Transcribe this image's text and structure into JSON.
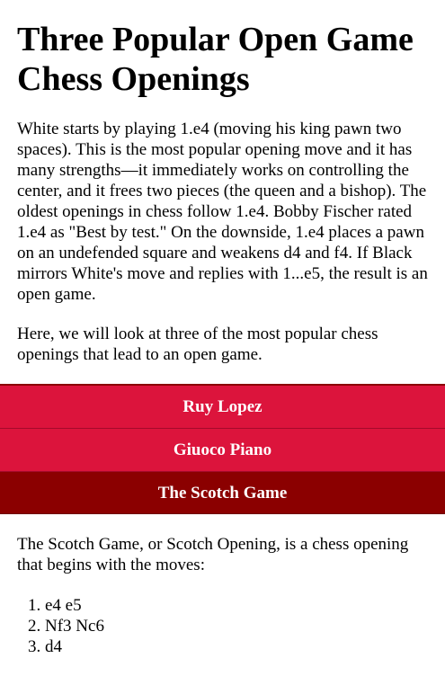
{
  "article": {
    "title": "Three Popular Open Game Chess Openings",
    "intro": "White starts by playing 1.e4 (moving his king pawn two spaces). This is the most popular opening move and it has many strengths—it immediately works on controlling the center, and it frees two pieces (the queen and a bishop). The oldest openings in chess follow 1.e4. Bobby Fischer rated 1.e4 as \"Best by test.\" On the downside, 1.e4 places a pawn on an undefended square and weakens d4 and f4. If Black mirrors White's move and replies with 1...e5, the result is an open game.",
    "intro2": "Here, we will look at three of the most popular chess openings that lead to an open game."
  },
  "tabs": [
    {
      "label": "Ruy Lopez",
      "active": false
    },
    {
      "label": "Giuoco Piano",
      "active": false
    },
    {
      "label": "The Scotch Game",
      "active": true
    }
  ],
  "panel": {
    "description": "The Scotch Game, or Scotch Opening, is a chess opening that begins with the moves:",
    "moves": [
      "e4 e5",
      "Nf3 Nc6",
      "d4"
    ]
  },
  "colors": {
    "tab_bg": "#dc143c",
    "tab_active_bg": "#8b0000",
    "tab_text": "#ffffff"
  }
}
